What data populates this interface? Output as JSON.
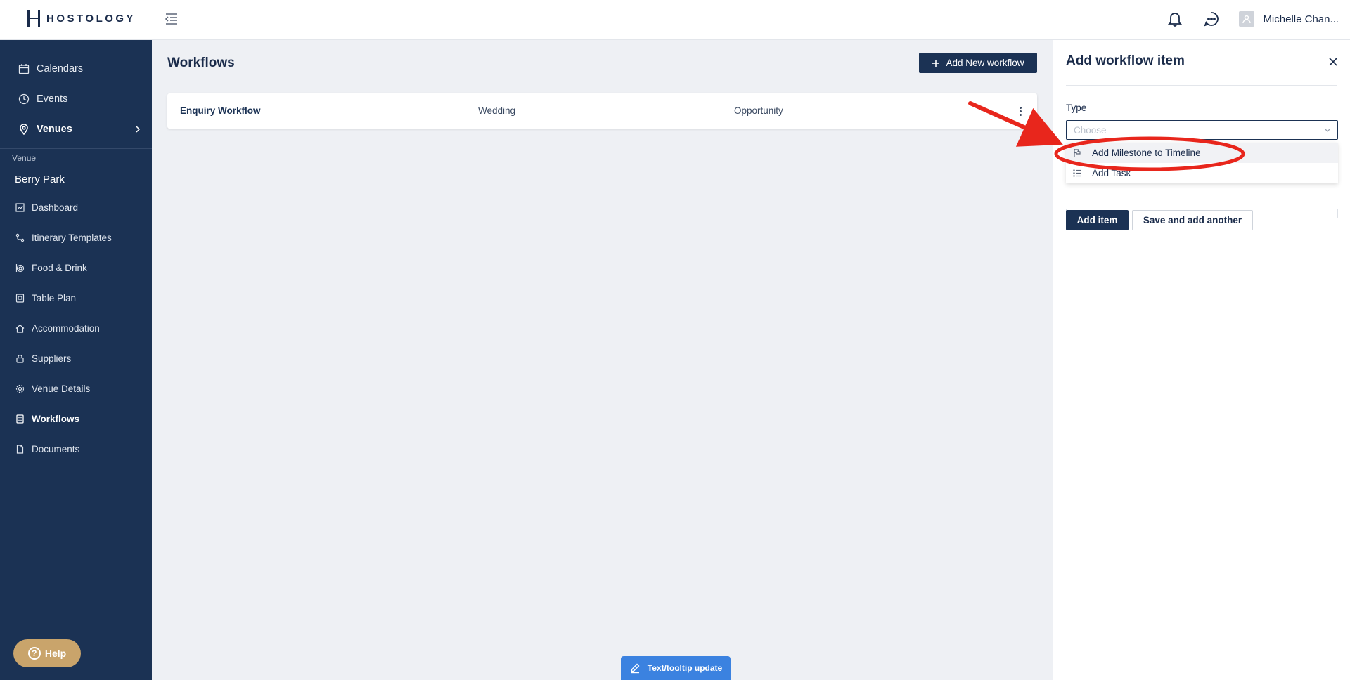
{
  "brand": {
    "name": "HOSTOLOGY"
  },
  "header": {
    "user_name": "Michelle Chan..."
  },
  "sidebar": {
    "top_items": [
      {
        "label": "Calendars",
        "icon": "calendar-icon"
      },
      {
        "label": "Events",
        "icon": "clock-icon"
      },
      {
        "label": "Venues",
        "icon": "map-pin-icon"
      }
    ],
    "venue_label": "Venue",
    "venue_name": "Berry Park",
    "venue_items": [
      {
        "label": "Dashboard",
        "icon": "chart-icon"
      },
      {
        "label": "Itinerary Templates",
        "icon": "route-icon"
      },
      {
        "label": "Food & Drink",
        "icon": "food-icon"
      },
      {
        "label": "Table Plan",
        "icon": "table-plan-icon"
      },
      {
        "label": "Accommodation",
        "icon": "home-icon"
      },
      {
        "label": "Suppliers",
        "icon": "lock-icon"
      },
      {
        "label": "Venue Details",
        "icon": "gear-icon"
      },
      {
        "label": "Workflows",
        "icon": "workflow-icon"
      },
      {
        "label": "Documents",
        "icon": "document-icon"
      }
    ],
    "help_label": "Help"
  },
  "main": {
    "title": "Workflows",
    "add_button": "Add New workflow",
    "workflows": [
      {
        "name": "Enquiry Workflow",
        "type": "Wedding",
        "stage": "Opportunity"
      }
    ],
    "tooltip_button": "Text/tooltip update"
  },
  "panel": {
    "title": "Add workflow item",
    "type_label": "Type",
    "type_placeholder": "Choose",
    "options": [
      {
        "label": "Add Milestone to Timeline",
        "icon": "flag-icon"
      },
      {
        "label": "Add Task",
        "icon": "list-icon"
      }
    ],
    "add_item_button": "Add item",
    "save_another_button": "Save and add another"
  },
  "colors": {
    "sidebar": "#1b3254",
    "primary": "#1b3254",
    "help": "#c9a46b",
    "annotation": "#e8261c",
    "tooltip": "#3b82e0"
  }
}
